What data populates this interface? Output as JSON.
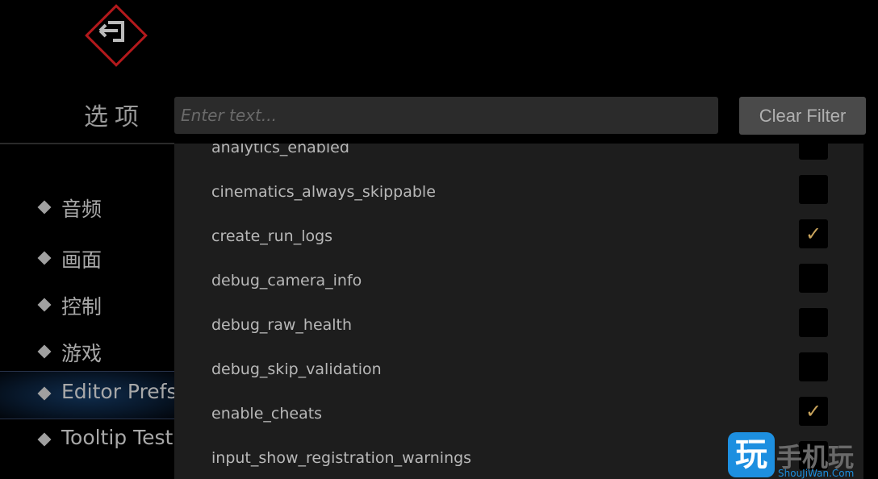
{
  "header": {
    "title": "选项",
    "logo_icon": "exit-door-icon"
  },
  "search": {
    "placeholder": "Enter text...",
    "value": ""
  },
  "clear_filter_label": "Clear Filter",
  "nav": {
    "items": [
      {
        "label": "音频",
        "active": false
      },
      {
        "label": "画面",
        "active": false
      },
      {
        "label": "控制",
        "active": false
      },
      {
        "label": "游戏",
        "active": false
      },
      {
        "label": "Editor Prefs",
        "active": true
      },
      {
        "label": "Tooltip Test",
        "active": false
      }
    ]
  },
  "prefs": [
    {
      "name": "analytics_enabled",
      "checked": false
    },
    {
      "name": "cinematics_always_skippable",
      "checked": false
    },
    {
      "name": "create_run_logs",
      "checked": true
    },
    {
      "name": "debug_camera_info",
      "checked": false
    },
    {
      "name": "debug_raw_health",
      "checked": false
    },
    {
      "name": "debug_skip_validation",
      "checked": false
    },
    {
      "name": "enable_cheats",
      "checked": true
    },
    {
      "name": "input_show_registration_warnings",
      "checked": false
    }
  ],
  "colors": {
    "check": "#c9a45c",
    "logo_red": "#b3191c",
    "active_nav": "#0f2c4c"
  },
  "watermark": {
    "icon_char": "玩",
    "text": "手机玩",
    "url_text": "ShouJiWan.Com"
  }
}
